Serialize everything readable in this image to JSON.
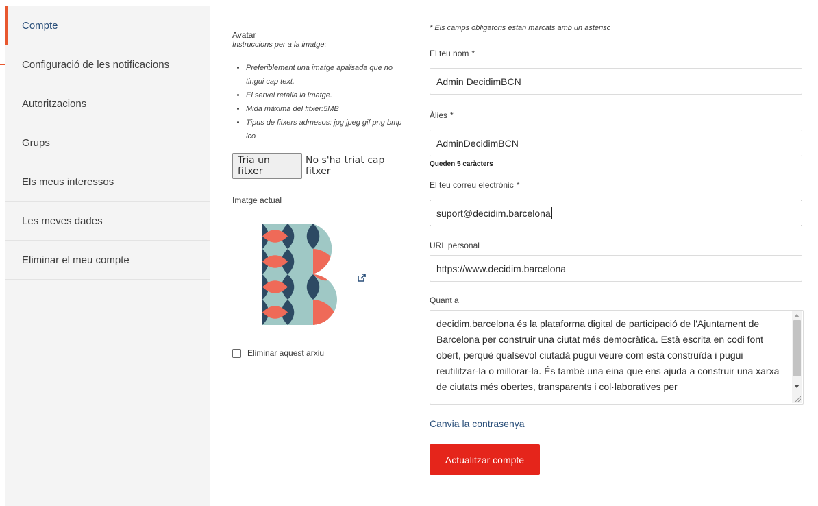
{
  "sidebar": {
    "items": [
      {
        "label": "Compte"
      },
      {
        "label": "Configuració de les notificacions"
      },
      {
        "label": "Autoritzacions"
      },
      {
        "label": "Grups"
      },
      {
        "label": "Els meus interessos"
      },
      {
        "label": "Les meves dades"
      },
      {
        "label": "Eliminar el meu compte"
      }
    ]
  },
  "avatar": {
    "title": "Avatar",
    "instructions_title": "Instruccions per a la imatge:",
    "instructions": [
      "Preferiblement una imatge apaïsada que no tingui cap text.",
      "El servei retalla la imatge.",
      "Mida màxima del fitxer:5MB",
      "Tipus de fitxers admesos: jpg jpeg gif png bmp ico"
    ],
    "file_button": "Tria un fitxer",
    "file_status": "No s'ha triat cap fitxer",
    "current_label": "Imatge actual",
    "delete_label": "Eliminar aquest arxiu",
    "image_colors": {
      "navy": "#2d4a63",
      "coral": "#ef6a58",
      "teal": "#9fc8c5"
    }
  },
  "form": {
    "required_note": "* Els camps obligatoris estan marcats amb un asterisc",
    "name": {
      "label": "El teu nom",
      "required": "*",
      "value": "Admin DecidimBCN"
    },
    "nickname": {
      "label": "Àlies",
      "required": "*",
      "value": "AdminDecidimBCN",
      "hint": "Queden 5 caràcters"
    },
    "email": {
      "label": "El teu correu electrònic",
      "required": "*",
      "value": "suport@decidim.barcelona"
    },
    "url": {
      "label": "URL personal",
      "value": "https://www.decidim.barcelona"
    },
    "about": {
      "label": "Quant a",
      "value": "decidim.barcelona és la plataforma digital de participació de l'Ajuntament de Barcelona per construir una ciutat més democràtica. Està escrita en codi font obert, perquè qualsevol ciutadà pugui veure com està construïda i pugui reutilitzar-la o millorar-la. És també una eina que ens ajuda a construir una xarxa de ciutats més obertes, transparents i col·laboratives per"
    },
    "change_password": "Canvia la contrasenya",
    "submit": "Actualitzar compte"
  },
  "colors": {
    "accent": "#e8582f",
    "button": "#e5251b",
    "link": "#2a4f7a"
  }
}
